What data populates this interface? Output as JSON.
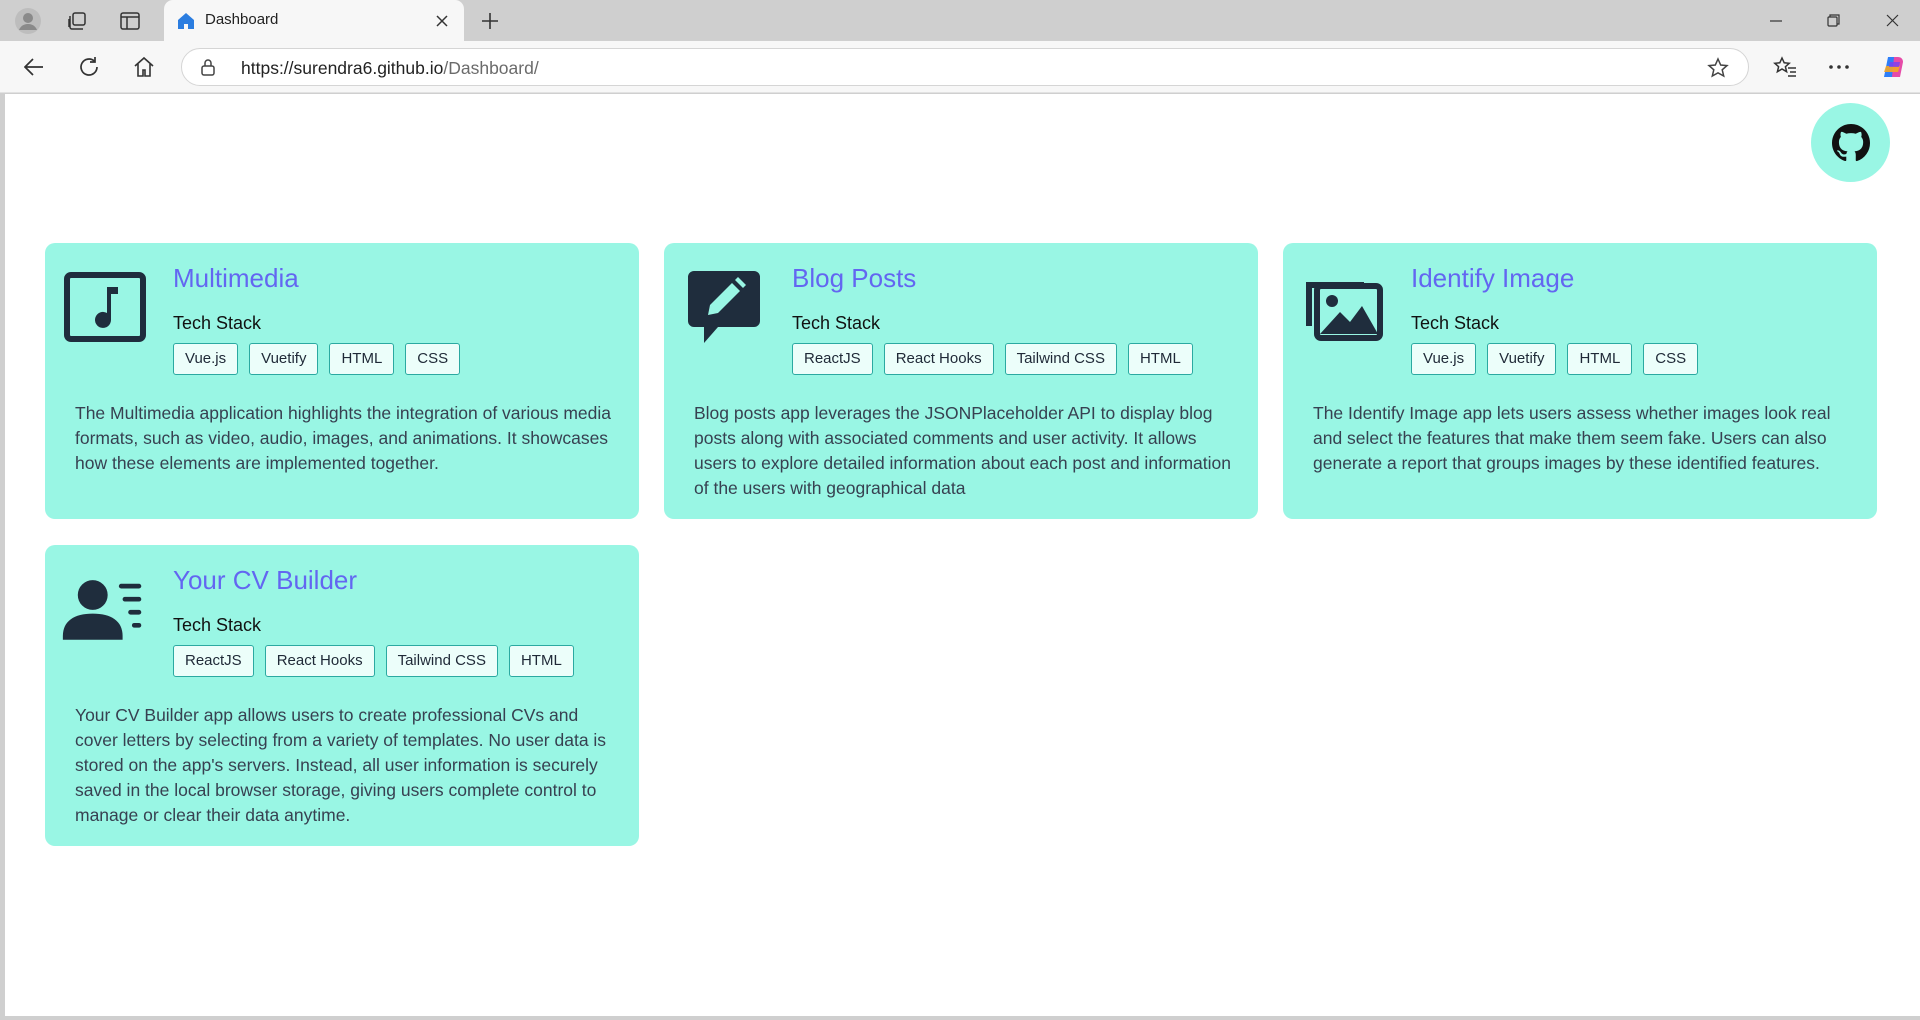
{
  "browser": {
    "tab_title": "Dashboard",
    "url_host": "https://surendra6.github.io",
    "url_path": "/Dashboard/"
  },
  "icons": {
    "profile": "profile-icon",
    "workspaces": "workspaces-icon",
    "tab_actions": "tab-actions-icon",
    "favicon": "home-icon",
    "close_tab": "close-icon",
    "new_tab": "plus-icon",
    "back": "back-arrow-icon",
    "refresh": "refresh-icon",
    "home": "home-icon",
    "lock": "lock-icon",
    "favorite": "star-icon",
    "favorites": "favorites-icon",
    "more": "more-icon",
    "copilot": "copilot-icon",
    "github": "github-icon"
  },
  "colors": {
    "card_bg": "#99f6e4",
    "title": "#6366f1",
    "icon": "#1f2d3d"
  },
  "cards": [
    {
      "title": "Multimedia",
      "subtitle": "Tech Stack",
      "tags": [
        "Vue.js",
        "Vuetify",
        "HTML",
        "CSS"
      ],
      "description": "The Multimedia application highlights the integration of various media formats, such as video, audio, images, and animations. It showcases how these elements are implemented together.",
      "icon": "music-note-icon"
    },
    {
      "title": "Blog Posts",
      "subtitle": "Tech Stack",
      "tags": [
        "ReactJS",
        "React Hooks",
        "Tailwind CSS",
        "HTML"
      ],
      "description": "Blog posts app leverages the JSONPlaceholder API to display blog posts along with associated comments and user activity. It allows users to explore detailed information about each post and information of the users with geographical data",
      "icon": "comment-edit-icon"
    },
    {
      "title": "Identify Image",
      "subtitle": "Tech Stack",
      "tags": [
        "Vue.js",
        "Vuetify",
        "HTML",
        "CSS"
      ],
      "description": "The Identify Image app lets users assess whether images look real and select the features that make them seem fake. Users can also generate a report that groups images by these identified features.",
      "icon": "images-icon"
    },
    {
      "title": "Your CV Builder",
      "subtitle": "Tech Stack",
      "tags": [
        "ReactJS",
        "React Hooks",
        "Tailwind CSS",
        "HTML"
      ],
      "description": "Your CV Builder app allows users to create professional CVs and cover letters by selecting from a variety of templates. No user data is stored on the app's servers. Instead, all user information is securely saved in the local browser storage, giving users complete control to manage or clear their data anytime.",
      "icon": "user-list-icon"
    }
  ]
}
